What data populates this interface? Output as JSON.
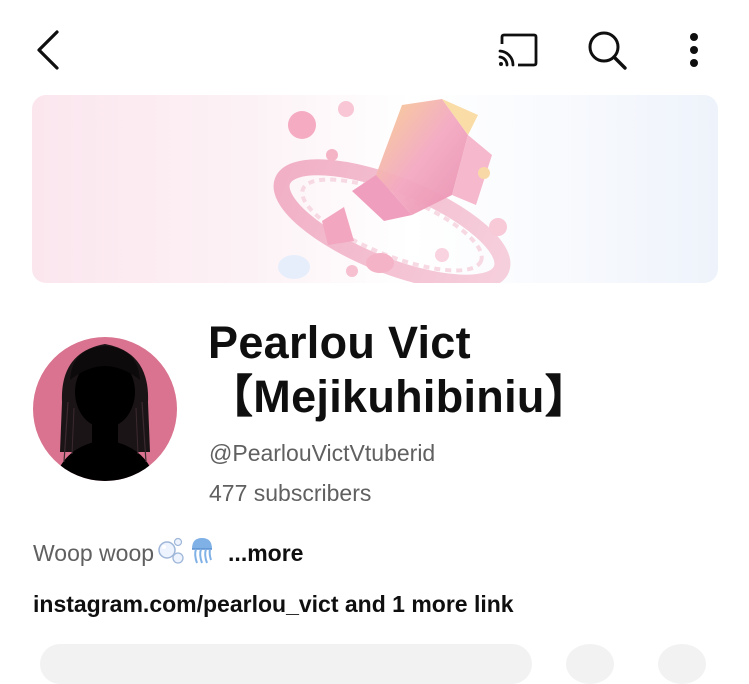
{
  "header": {
    "back_icon": "chevron-left-icon",
    "cast_icon": "cast-icon",
    "search_icon": "search-icon",
    "more_icon": "more-vertical-icon"
  },
  "channel": {
    "name_line1": "Pearlou Vict",
    "name_line2": "【Mejikuhibiniu】",
    "handle": "@PearlouVictVtuberid",
    "subscribers": "477 subscribers"
  },
  "description": {
    "text": "Woop woop",
    "emojis": [
      "bubbles-emoji",
      "jellyfish-emoji"
    ],
    "more_label": "...more"
  },
  "links": {
    "text": "instagram.com/pearlou_vict and 1 more link"
  },
  "colors": {
    "primary_text": "#0f0f0f",
    "secondary_text": "#606060",
    "avatar_bg": "#d9738f",
    "banner_pink": "#f4b6c8",
    "banner_gold": "#f7cf8e"
  }
}
